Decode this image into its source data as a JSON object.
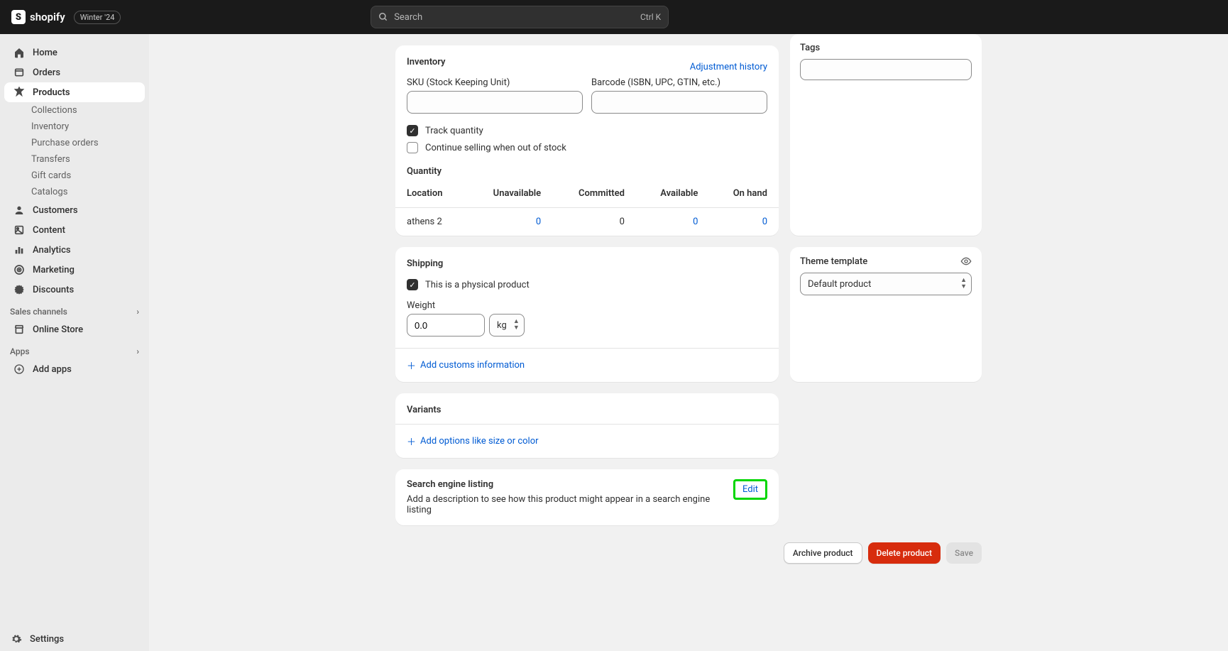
{
  "topbar": {
    "logo_text": "shopify",
    "version_badge": "Winter '24",
    "search_placeholder": "Search",
    "search_shortcut": "Ctrl K"
  },
  "sidebar": {
    "home": "Home",
    "orders": "Orders",
    "products": "Products",
    "products_subs": {
      "collections": "Collections",
      "inventory": "Inventory",
      "purchase_orders": "Purchase orders",
      "transfers": "Transfers",
      "gift_cards": "Gift cards",
      "catalogs": "Catalogs"
    },
    "customers": "Customers",
    "content": "Content",
    "analytics": "Analytics",
    "marketing": "Marketing",
    "discounts": "Discounts",
    "sales_channels": "Sales channels",
    "online_store": "Online Store",
    "apps_section": "Apps",
    "add_apps": "Add apps",
    "settings": "Settings"
  },
  "inventory": {
    "title": "Inventory",
    "adjustment_link": "Adjustment history",
    "sku_label": "SKU (Stock Keeping Unit)",
    "sku_value": "",
    "barcode_label": "Barcode (ISBN, UPC, GTIN, etc.)",
    "barcode_value": "",
    "track_quantity_label": "Track quantity",
    "continue_selling_label": "Continue selling when out of stock",
    "quantity_title": "Quantity",
    "columns": {
      "location": "Location",
      "unavailable": "Unavailable",
      "committed": "Committed",
      "available": "Available",
      "on_hand": "On hand"
    },
    "rows": [
      {
        "location": "athens 2",
        "unavailable": "0",
        "committed": "0",
        "available": "0",
        "on_hand": "0"
      }
    ]
  },
  "shipping": {
    "title": "Shipping",
    "physical_label": "This is a physical product",
    "weight_label": "Weight",
    "weight_value": "0.0",
    "weight_unit": "kg",
    "customs_link": "Add customs information"
  },
  "variants": {
    "title": "Variants",
    "add_options_link": "Add options like size or color"
  },
  "seo": {
    "title": "Search engine listing",
    "edit": "Edit",
    "desc": "Add a description to see how this product might appear in a search engine listing"
  },
  "tags": {
    "title": "Tags",
    "value": ""
  },
  "theme": {
    "title": "Theme template",
    "value": "Default product"
  },
  "footer": {
    "archive": "Archive product",
    "delete": "Delete product",
    "save": "Save"
  }
}
